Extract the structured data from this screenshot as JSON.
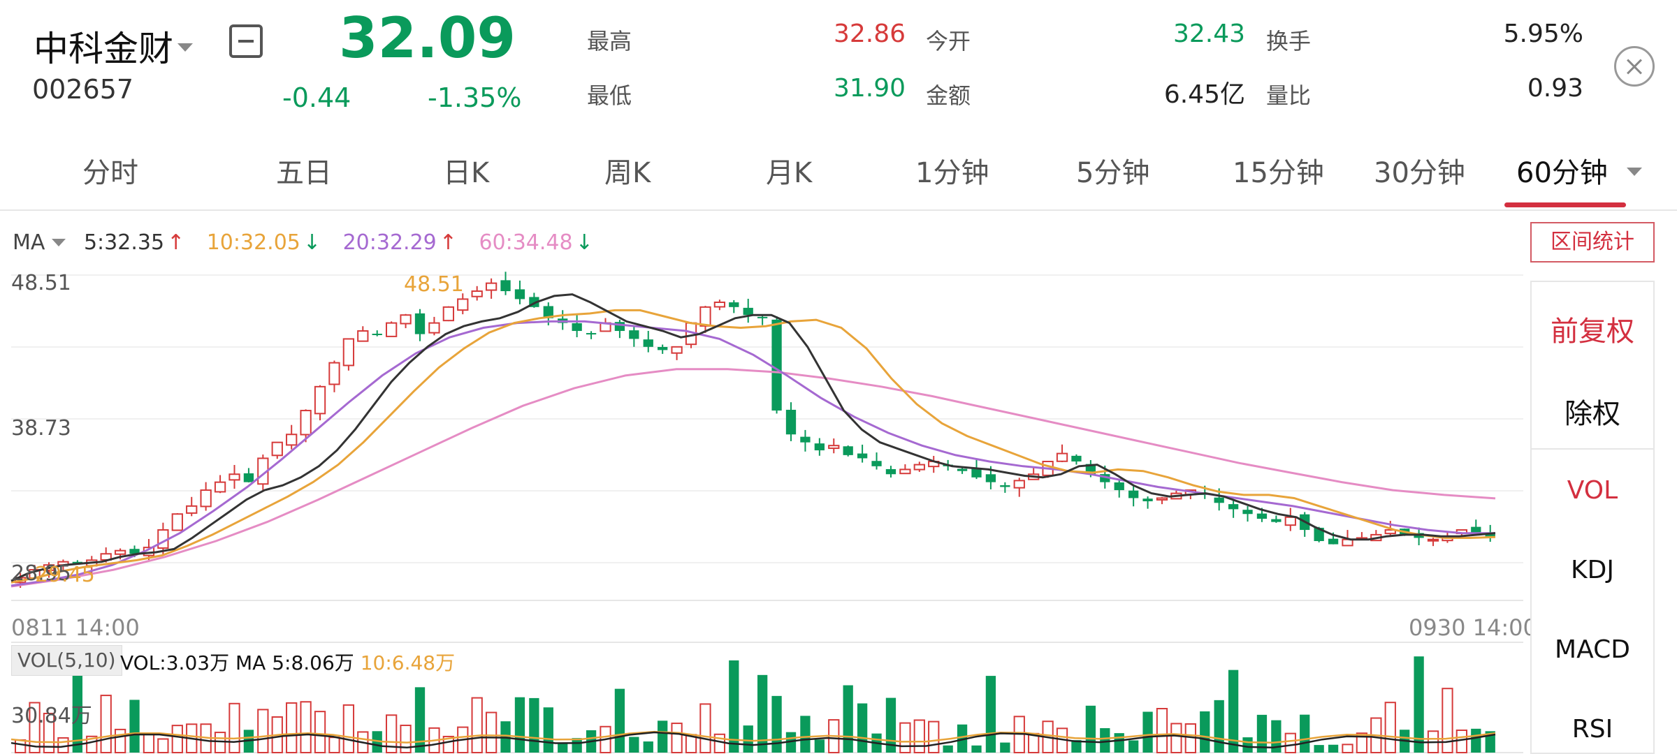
{
  "header": {
    "stock_name": "中科金财",
    "stock_code": "002657",
    "price": "32.09",
    "change": "-0.44",
    "change_pct": "-1.35%",
    "stats": [
      {
        "label": "最高",
        "value": "32.86",
        "color": "red"
      },
      {
        "label": "最低",
        "value": "31.90",
        "color": "green"
      },
      {
        "label": "今开",
        "value": "32.43",
        "color": "green"
      },
      {
        "label": "金额",
        "value": "6.45亿",
        "color": "dark"
      },
      {
        "label": "换手",
        "value": "5.95%",
        "color": "dark"
      },
      {
        "label": "量比",
        "value": "0.93",
        "color": "dark"
      }
    ]
  },
  "tabs": [
    {
      "label": "分时"
    },
    {
      "label": "五日"
    },
    {
      "label": "日K"
    },
    {
      "label": "周K"
    },
    {
      "label": "月K"
    },
    {
      "label": "1分钟"
    },
    {
      "label": "5分钟"
    },
    {
      "label": "15分钟"
    },
    {
      "label": "30分钟"
    },
    {
      "label": "60分钟",
      "active": true
    }
  ],
  "ma_legend": {
    "label": "MA",
    "items": [
      {
        "text": "5:32.35",
        "arrow": "↑",
        "color": "#333333",
        "arrow_color": "#d63a3a"
      },
      {
        "text": "10:32.05",
        "arrow": "↓",
        "color": "#e8a43a",
        "arrow_color": "#0a9a5b"
      },
      {
        "text": "20:32.29",
        "arrow": "↑",
        "color": "#a569d1",
        "arrow_color": "#d63a3a"
      },
      {
        "text": "60:34.48",
        "arrow": "↓",
        "color": "#e58cc4",
        "arrow_color": "#0a9a5b"
      }
    ]
  },
  "range_stat_label": "区间统计",
  "side_panel": {
    "items": [
      "前复权",
      "除权",
      "VOL",
      "KDJ",
      "MACD",
      "RSI"
    ]
  },
  "chart": {
    "y_top_label": "48.51",
    "y_mid_label": "38.73",
    "y_bottom_label": "28.95",
    "high_marker": "48.51",
    "low_marker": "29.45",
    "x_start": "0811 14:00",
    "x_end": "0930 14:00"
  },
  "volume": {
    "tag": "VOL(5,10)",
    "vol_text": "VOL:3.03万",
    "ma5_text": "MA 5:8.06万",
    "ma10_text": "10:6.48万",
    "max_label": "30.84万"
  },
  "colors": {
    "up": "#d63a3a",
    "down": "#0a9a5b",
    "accent": "#d32f3f"
  },
  "chart_data": {
    "type": "candlestick",
    "ylim": [
      28.95,
      48.51
    ],
    "x_start": "0811 14:00",
    "x_end": "0930 14:00",
    "close_series_approx": [
      29.5,
      30.0,
      30.3,
      30.5,
      30.4,
      30.6,
      31.0,
      31.2,
      31.0,
      31.4,
      32.5,
      33.5,
      34.0,
      35.0,
      35.5,
      36.0,
      35.5,
      37.0,
      38.0,
      38.5,
      40.0,
      41.5,
      43.0,
      44.5,
      45.0,
      44.8,
      45.5,
      46.0,
      44.8,
      45.5,
      46.5,
      47.0,
      47.5,
      48.0,
      47.5,
      47.0,
      46.5,
      45.8,
      45.5,
      45.0,
      44.8,
      45.5,
      45.0,
      44.5,
      44.0,
      43.8,
      44.0,
      45.5,
      46.5,
      46.8,
      46.5,
      46.0,
      45.8,
      40.0,
      38.5,
      38.0,
      37.5,
      37.8,
      37.2,
      37.0,
      36.5,
      36.0,
      36.3,
      36.6,
      36.8,
      36.5,
      36.2,
      35.8,
      35.5,
      35.2,
      35.6,
      36.0,
      36.8,
      37.3,
      36.8,
      36.0,
      35.5,
      35.0,
      34.5,
      34.3,
      34.5,
      34.8,
      35.0,
      34.7,
      34.2,
      33.8,
      33.5,
      33.2,
      33.0,
      33.3,
      32.5,
      31.8,
      31.6,
      31.9,
      32.0,
      32.2,
      32.5,
      32.2,
      32.0,
      31.9,
      32.1,
      32.5,
      32.3,
      32.09
    ],
    "ma5_approx": [
      29.3,
      29.8,
      30.1,
      30.3,
      30.4,
      30.5,
      30.8,
      31.0,
      31.1,
      31.3,
      32.0,
      32.8,
      33.6,
      34.4,
      35.0,
      35.3,
      35.8,
      36.5,
      37.5,
      38.8,
      40.3,
      41.8,
      43.0,
      44.0,
      44.8,
      45.3,
      45.6,
      45.8,
      46.2,
      46.8,
      47.2,
      47.3,
      46.8,
      46.2,
      45.6,
      45.3,
      45.0,
      44.6,
      44.8,
      45.3,
      45.8,
      46.0,
      46.0,
      45.5,
      44.0,
      42.0,
      40.0,
      38.8,
      38.0,
      37.6,
      37.2,
      36.8,
      36.5,
      36.4,
      36.3,
      36.1,
      35.9,
      35.8,
      36.0,
      36.5,
      36.6,
      36.0,
      35.3,
      34.8,
      34.6,
      34.7,
      34.8,
      34.6,
      34.2,
      33.8,
      33.5,
      33.3,
      32.7,
      32.2,
      31.9,
      31.9,
      32.1,
      32.2,
      32.2,
      32.1,
      32.1,
      32.2,
      32.3
    ],
    "ma10_approx": [
      29.2,
      29.5,
      29.9,
      30.2,
      30.4,
      30.6,
      30.9,
      31.5,
      32.2,
      33.0,
      33.8,
      34.6,
      35.5,
      36.6,
      38.0,
      39.6,
      41.2,
      42.7,
      43.9,
      44.9,
      45.5,
      45.8,
      46.0,
      46.1,
      46.3,
      46.3,
      45.9,
      45.5,
      45.3,
      45.2,
      45.3,
      45.6,
      45.7,
      45.2,
      43.9,
      42.0,
      40.4,
      39.2,
      38.4,
      37.8,
      37.2,
      36.6,
      36.2,
      36.1,
      36.3,
      36.2,
      35.8,
      35.3,
      34.9,
      34.7,
      34.7,
      34.5,
      34.0,
      33.5,
      33.0,
      32.5,
      32.2,
      32.0,
      32.0,
      32.05
    ],
    "ma20_approx": [
      29.0,
      29.3,
      29.7,
      30.3,
      31.2,
      32.3,
      33.7,
      35.2,
      36.9,
      38.7,
      40.5,
      42.2,
      43.6,
      44.6,
      45.2,
      45.5,
      45.6,
      45.6,
      45.4,
      45.2,
      45.0,
      44.5,
      43.5,
      42.2,
      40.8,
      39.6,
      38.6,
      37.8,
      37.2,
      36.8,
      36.5,
      36.3,
      36.0,
      35.6,
      35.2,
      34.9,
      34.6,
      34.3,
      34.0,
      33.6,
      33.2,
      32.8,
      32.5,
      32.3,
      32.29
    ],
    "ma60_approx": [
      28.95,
      29.4,
      30.0,
      30.8,
      31.8,
      33.0,
      34.4,
      35.9,
      37.4,
      38.9,
      40.3,
      41.4,
      42.2,
      42.6,
      42.6,
      42.4,
      42.0,
      41.5,
      40.9,
      40.2,
      39.5,
      38.8,
      38.1,
      37.4,
      36.7,
      36.1,
      35.5,
      35.0,
      34.7,
      34.48
    ],
    "volume_max": "30.84万",
    "last_volume": "3.03万"
  }
}
